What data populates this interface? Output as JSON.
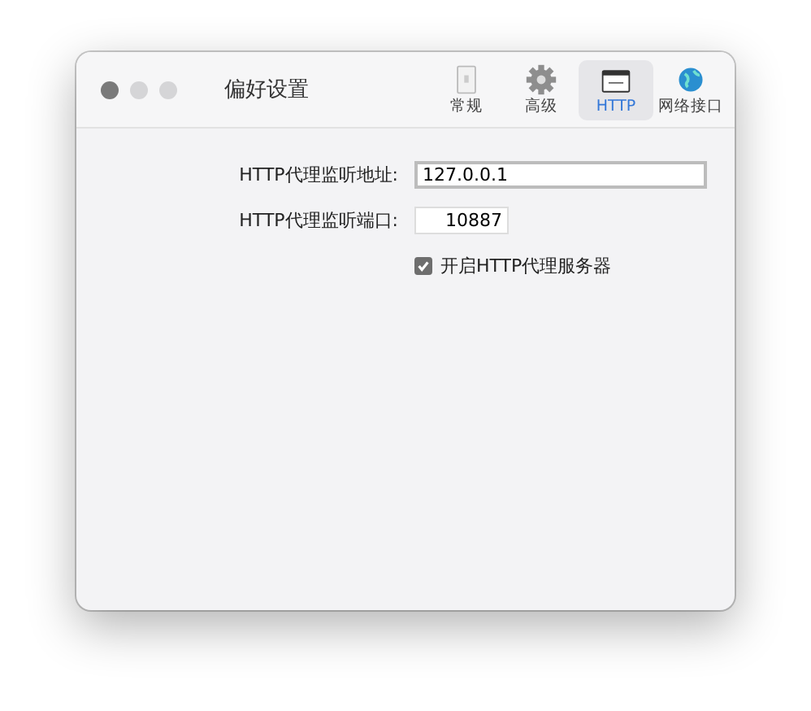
{
  "window": {
    "title": "偏好设置"
  },
  "tabs": [
    {
      "kind": "general",
      "label": "常规",
      "selected": false
    },
    {
      "kind": "advanced",
      "label": "高级",
      "selected": false
    },
    {
      "kind": "http",
      "label": "HTTP",
      "selected": true
    },
    {
      "kind": "network",
      "label": "网络接口",
      "selected": false
    }
  ],
  "fields": [
    {
      "label": "HTTP代理监听地址:",
      "value": "127.0.0.1",
      "kind": "wide"
    },
    {
      "label": "HTTP代理监听端口:",
      "value": "10887",
      "kind": "port"
    }
  ],
  "checkbox": {
    "label": "开启HTTP代理服务器",
    "checked": true
  }
}
